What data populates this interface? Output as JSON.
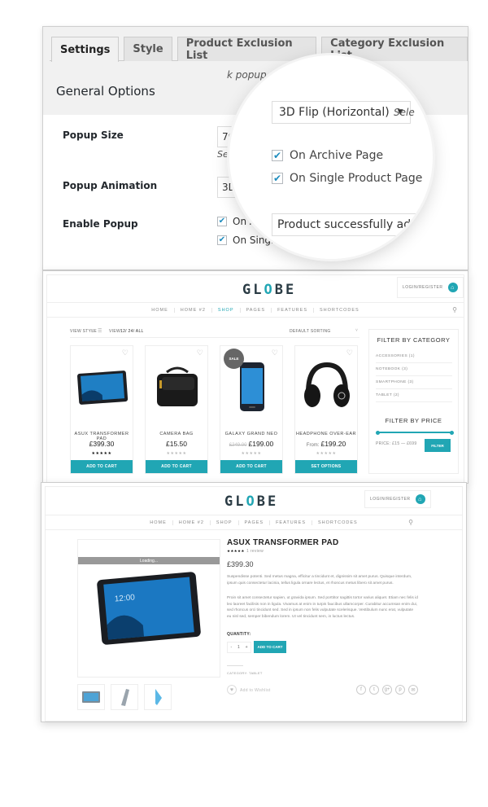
{
  "admin": {
    "tabs": [
      {
        "label": "Settings",
        "active": true
      },
      {
        "label": "Style",
        "active": false
      },
      {
        "label": "Product Exclusion List",
        "active": false
      },
      {
        "label": "Category Exclusion List",
        "active": false
      }
    ],
    "section_title": "General Options",
    "popup_size_hint_partial": "k popup size.",
    "fields": {
      "popup_size": {
        "label": "Popup Size",
        "value_partial": "70",
        "hint_partial": "Set"
      },
      "popup_animation": {
        "label": "Popup Animation",
        "value_partial": "3D"
      },
      "enable_popup": {
        "label": "Enable Popup",
        "options": [
          {
            "label_partial": "On A",
            "checked": true
          },
          {
            "label_partial": "On Single",
            "checked": true
          }
        ]
      }
    },
    "magnifier": {
      "animation_select": "3D Flip (Horizontal)",
      "animation_hint_partial": "Sele",
      "enable_options": [
        {
          "label": "On Archive Page",
          "checked": true
        },
        {
          "label": "On Single Product Page",
          "checked": true
        }
      ],
      "message_value_partial": "Product successfully add"
    }
  },
  "shop": {
    "logo": {
      "left": "GL",
      "mid": "O",
      "right": "BE"
    },
    "login_label": "LOGIN/REGISTER",
    "nav": [
      "HOME",
      "HOME #2",
      "SHOP",
      "PAGES",
      "FEATURES",
      "SHORTCODES"
    ],
    "nav_active_shop_page": "SHOP",
    "toolbar": {
      "view_style_label": "VIEW STYLE",
      "view_label": "VIEW:",
      "view_options": "12/ 24/ ALL",
      "sorting": "DEFAULT SORTING"
    },
    "products": [
      {
        "name": "ASUX TRANSFORMER PAD",
        "price": "£399.30",
        "old_price": "",
        "prefix": "",
        "rated": true,
        "button": "ADD TO CART",
        "sale": false
      },
      {
        "name": "CAMERA BAG",
        "price": "£15.50",
        "old_price": "",
        "prefix": "",
        "rated": false,
        "button": "ADD TO CART",
        "sale": false
      },
      {
        "name": "GALAXY GRAND NEO",
        "price": "£199.00",
        "old_price": "£249.00",
        "prefix": "",
        "rated": false,
        "button": "ADD TO CART",
        "sale": true
      },
      {
        "name": "HEADPHONE OVER-EAR",
        "price": "£199.20",
        "old_price": "",
        "prefix": "From:",
        "rated": false,
        "button": "SET OPTIONS",
        "sale": false
      }
    ],
    "sale_badge": "SALE",
    "sidebar": {
      "category_title": "FILTER BY CATEGORY",
      "categories": [
        {
          "name": "ACCESSORIES",
          "count": "1"
        },
        {
          "name": "NOTEBOOK",
          "count": "3"
        },
        {
          "name": "SMARTPHONE",
          "count": "3"
        },
        {
          "name": "TABLET",
          "count": "2"
        }
      ],
      "price_title": "FILTER BY PRICE",
      "price_range_text": "PRICE: £15 — £699",
      "price_min": 15,
      "price_max": 699,
      "filter_button": "FILTER"
    }
  },
  "product_page": {
    "loading_text": "Loading...",
    "title": "ASUX TRANSFORMER PAD",
    "stars": "★★★★★",
    "review_count": "1 review",
    "price": "£399.30",
    "description_1": "Suspendisse potenti. Sed metus magna, efficitur a tincidunt et, dignissim sit amet purus. Quisque interdum, ipsum quis consectetur lacinia, tellus ligula ornare lectus, et rhoncus metus libero sit amet purus.",
    "description_2": "Proin sit amet consectetur sapien, ut gravida ipsum. Sed porttitor sagittis tortor varius aliquet. Etiam nec felis id leo laoreet facilisis non in ligula. Vivamus at enim in turpis faucibus ullamcorper. Curabitur accumsan enim dui, sed rhoncus orci tincidunt sed. Sed in ipsum non felis vulputate scelerisque. Vestibulum nunc erat, vulputate eu nisl sed, semper bibendum lorem. Ut vel tincidunt sem, in luctus lectus.",
    "quantity_label": "QUANTITY:",
    "quantity_value": "1",
    "qty_minus": "-",
    "qty_plus": "+",
    "add_to_cart": "ADD TO CART",
    "category_text": "CATEGORY: TABLET",
    "wishlist": "Add to Wishlist",
    "share_icons": [
      "f",
      "t",
      "g+",
      "p",
      "✉"
    ]
  },
  "colors": {
    "accent": "#21a6b4",
    "checkbox_blue": "#1e8cbe",
    "admin_bg": "#f1f1f1"
  }
}
